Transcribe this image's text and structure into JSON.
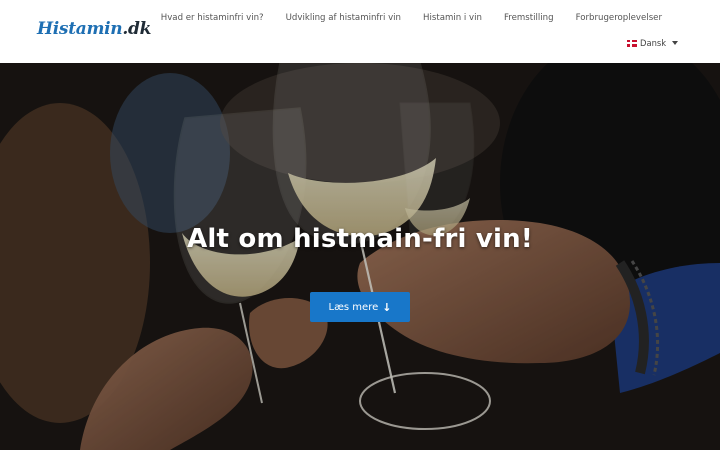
{
  "logo": {
    "main": "Histamin",
    "tld": ".dk"
  },
  "nav": {
    "items": [
      {
        "label": "Hvad er histaminfri vin?"
      },
      {
        "label": "Udvikling af histaminfri vin"
      },
      {
        "label": "Histamin i vin"
      },
      {
        "label": "Fremstilling"
      },
      {
        "label": "Forbrugeroplevelser"
      }
    ]
  },
  "language": {
    "label": "Dansk",
    "icon": "danish-flag-icon"
  },
  "hero": {
    "title": "Alt om histmain-fri vin!",
    "cta_label": "Læs mere",
    "cta_icon": "arrow-down-icon"
  },
  "colors": {
    "brand": "#1e6fb3",
    "cta": "#1877c9"
  }
}
